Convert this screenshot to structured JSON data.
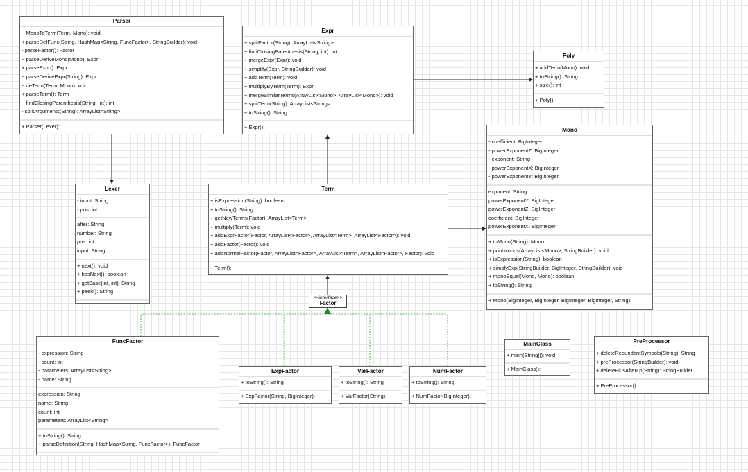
{
  "classes": [
    {
      "id": "parser",
      "name": "Parser",
      "sections": [
        [
          "~ MonoToTerm(Term, Mono): void",
          "+ parseDefFunc(String, HashMap<String, FuncFactor>, StringBuilder): void",
          "- parseFactor(): Factor",
          "~ parseDeriveMono(Mono): Expr",
          "+ parseExpr(): Expr",
          "~ parseDeriveExpr(String): Expr",
          "~ deTerm(Term, Mono): void",
          "+ parseTerm(): Term",
          "~ findClosingParenthesis(String, int): int",
          "- splitArguments(String): ArrayList<String>"
        ],
        [
          "+ Parser(Lexer):"
        ]
      ]
    },
    {
      "id": "expr",
      "name": "Expr",
      "sections": [
        [
          "+ splitFactor(String): ArrayList<String>",
          "~ findClosingParenthesis(String, int): int",
          "+ mergeExpr(Expr): void",
          "+ simplify(Expr, StringBuilder): void",
          "+ addTerm(Term): void",
          "+ multiplyByTerm(Term): Expr",
          "+ mergeSimilarTerms(ArrayList<Mono>, ArrayList<Mono>): void",
          "+ splitTerm(String): ArrayList<String>",
          "+ toString(): String"
        ],
        [
          "+ Expr():"
        ]
      ]
    },
    {
      "id": "poly",
      "name": "Poly",
      "sections": [
        [
          "+ addTerm(Mono): void",
          "+ toString(): String",
          "+ size(): int"
        ],
        [
          "+ Poly():"
        ]
      ]
    },
    {
      "id": "mono",
      "name": "Mono",
      "sections": [
        [
          "- coefficient: BigInteger",
          "- powerExponentZ: BigInteger",
          "- exponent: String",
          "- powerExponentX: BigInteger",
          "- powerExponentY: BigInteger"
        ],
        [
          "exponent: String",
          "powerExponentY: BigInteger",
          "powerExponentZ: BigInteger",
          "coefficient: BigInteger",
          "powerExponentX: BigInteger"
        ],
        [
          "+ toMono(String): Mono",
          "+ printMonos(ArrayList<Mono>, StringBuilder): void",
          "+ isExpression(String): boolean",
          "+ simplyExp(StringBuilder, BigInteger, StringBuilder): void",
          "+ monoEqual(Mono, Mono): boolean",
          "+ toString(): String"
        ],
        [
          "+ Mono(BigInteger, BigInteger, BigInteger, BigInteger, String):"
        ]
      ]
    },
    {
      "id": "lexer",
      "name": "Lexer",
      "sections": [
        [
          "- input: String",
          "- pos: int"
        ],
        [
          "after: String",
          "number: String",
          "pos: int",
          "input: String"
        ],
        [
          "+ next(): void",
          "+ hasNext(): boolean",
          "+ getBase(int, int): String",
          "+ peek(): String"
        ],
        []
      ]
    },
    {
      "id": "term",
      "name": "Term",
      "sections": [
        [
          "+ isExpression(String): boolean",
          "+ toString(): String",
          "+ getNewTerms(Factor): ArrayList<Term>",
          "+ multiply(Term): void",
          "+ addExprFactor(Factor, ArrayList<Factor>, ArrayList<Term>, ArrayList<Factor>): void",
          "+ addFactor(Factor): void",
          "+ addNormalFactor(Factor, ArrayList<Factor>, ArrayList<Term>, ArrayList<Factor>, Factor): void"
        ],
        [
          "+ Term():"
        ]
      ]
    },
    {
      "id": "funcfactor",
      "name": "FuncFactor",
      "sections": [
        [
          "- expression: String",
          "- count: int",
          "- parameters: ArrayList<String>",
          "- name: String"
        ],
        [
          "expression: String",
          "name: String",
          "count: int",
          "parameters: ArrayList<String>"
        ],
        [
          "+ toString(): String",
          "+ parseDefinition(String, HashMap<String, FuncFactor>): FuncFactor"
        ],
        []
      ]
    },
    {
      "id": "expfactor",
      "name": "ExpFactor",
      "sections": [
        [
          "+ toString(): String"
        ],
        [
          "+ ExpFactor(String, BigInteger):"
        ]
      ]
    },
    {
      "id": "varfactor",
      "name": "VarFactor",
      "sections": [
        [
          "+ toString(): String"
        ],
        [
          "+ VarFactor(String):"
        ]
      ]
    },
    {
      "id": "numfactor",
      "name": "NumFactor",
      "sections": [
        [
          "+ toString(): String"
        ],
        [
          "+ NumFactor(BigInteger):"
        ]
      ]
    },
    {
      "id": "mainclass",
      "name": "MainClass",
      "sections": [
        [
          "+ main(String[]): void"
        ],
        [
          "+ MainClass():"
        ]
      ]
    },
    {
      "id": "preprocessor",
      "name": "PreProcessor",
      "sections": [
        [
          "+ deleteRedundantSymbols(String): String",
          "+ preProcessor(StringBuilder): void",
          "+ deletePlusAfterLp(String): StringBuilder"
        ],
        [
          "+ PreProcessor():"
        ]
      ]
    }
  ],
  "interface": {
    "stereotype": "<<interface>>",
    "name": "Factor"
  },
  "colors": {
    "realization": "#2e9e2e",
    "association": "#222222",
    "border": "#666666"
  }
}
